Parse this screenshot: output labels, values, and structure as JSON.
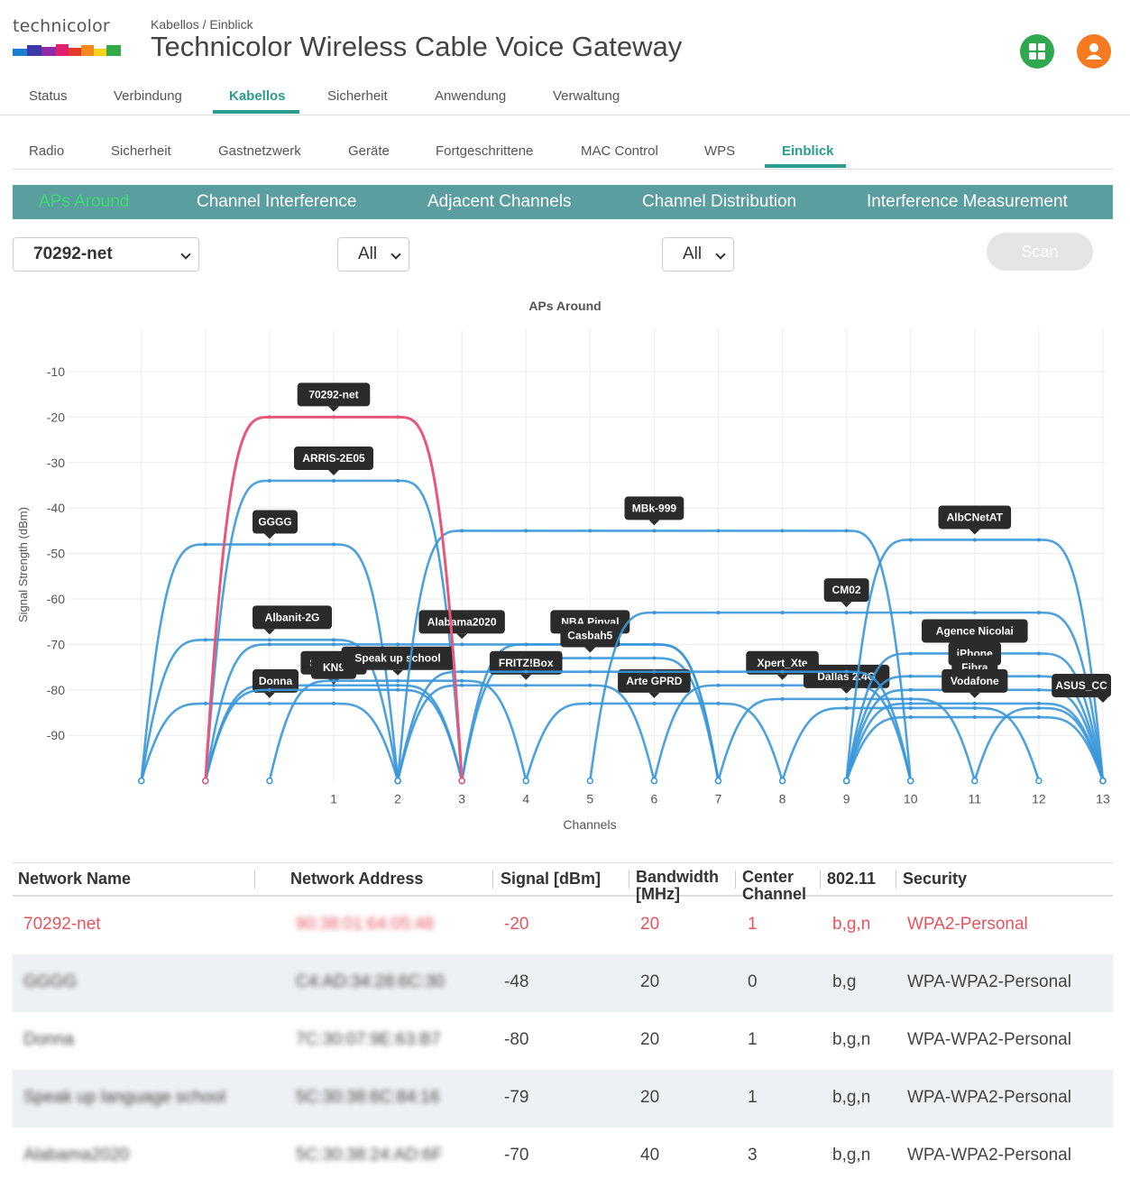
{
  "header": {
    "logo_text": "technicolor",
    "breadcrumb": "Kabellos / Einblick",
    "title": "Technicolor Wireless Cable Voice Gateway"
  },
  "main_nav": {
    "items": [
      "Status",
      "Verbindung",
      "Kabellos",
      "Sicherheit",
      "Anwendung",
      "Verwaltung"
    ],
    "active": "Kabellos"
  },
  "sub_nav": {
    "items": [
      "Radio",
      "Sicherheit",
      "Gastnetzwerk",
      "Geräte",
      "Fortgeschrittene",
      "MAC Control",
      "WPS",
      "Einblick"
    ],
    "active": "Einblick"
  },
  "tabs": {
    "items": [
      "APs Around",
      "Channel Interference",
      "Adjacent Channels",
      "Channel Distribution",
      "Interference Measurement"
    ],
    "active": "APs Around"
  },
  "filters": {
    "network": "70292-net",
    "filter2": "All",
    "filter3": "All",
    "scan_label": "Scan"
  },
  "chart_data": {
    "type": "line",
    "title": "APs Around",
    "xlabel": "Channels",
    "ylabel": "Signal Strength (dBm)",
    "x_ticks": [
      1,
      2,
      3,
      4,
      5,
      6,
      7,
      8,
      9,
      10,
      11,
      12,
      13
    ],
    "xlim": [
      -2,
      13
    ],
    "y_ticks": [
      -10,
      -20,
      -30,
      -40,
      -50,
      -60,
      -70,
      -80,
      -90
    ],
    "ylim": [
      -100,
      -5
    ],
    "grid": true,
    "highlight_color": "#e8577a",
    "series_color": "#3a97d9",
    "series": [
      {
        "name": "70292-net",
        "center": 1,
        "bandwidth": 20,
        "signal": -20,
        "highlight": true
      },
      {
        "name": "ARRIS-2E05",
        "center": 1,
        "bandwidth": 20,
        "signal": -34
      },
      {
        "name": "GGGG",
        "center": 0,
        "bandwidth": 20,
        "signal": -48
      },
      {
        "name": "Albanit-2G",
        "center": 0,
        "bandwidth": 20,
        "signal": -69
      },
      {
        "name": "Speak up",
        "center": 1,
        "bandwidth": 20,
        "signal": -79
      },
      {
        "name": "Donna",
        "center": 0,
        "bandwidth": 20,
        "signal": -83
      },
      {
        "name": "KN9",
        "center": 1,
        "bandwidth": 20,
        "signal": -80
      },
      {
        "name": "Speak up school",
        "center": 2,
        "bandwidth": 20,
        "signal": -78
      },
      {
        "name": "Alabama2020",
        "center": 3,
        "bandwidth": 40,
        "signal": -70
      },
      {
        "name": "MBk-999",
        "center": 6,
        "bandwidth": 40,
        "signal": -45
      },
      {
        "name": "NBA Pinval",
        "center": 5,
        "bandwidth": 20,
        "signal": -70
      },
      {
        "name": "Casbah5",
        "center": 5,
        "bandwidth": 20,
        "signal": -73
      },
      {
        "name": "FRITZ!Box",
        "center": 4,
        "bandwidth": 20,
        "signal": -79
      },
      {
        "name": "Arte GPRD",
        "center": 6,
        "bandwidth": 20,
        "signal": -83
      },
      {
        "name": "Xpert_Xte",
        "center": 8,
        "bandwidth": 20,
        "signal": -79
      },
      {
        "name": "Dallas 2.4G",
        "center": 9,
        "bandwidth": 20,
        "signal": -82
      },
      {
        "name": "CM02",
        "center": 9,
        "bandwidth": 40,
        "signal": -63
      },
      {
        "name": "AlbCNetAT",
        "center": 11,
        "bandwidth": 20,
        "signal": -47
      },
      {
        "name": "Agence Nicolai",
        "center": 11,
        "bandwidth": 20,
        "signal": -72
      },
      {
        "name": "iPhone",
        "center": 11,
        "bandwidth": 20,
        "signal": -77
      },
      {
        "name": "Fibra",
        "center": 11,
        "bandwidth": 20,
        "signal": -80
      },
      {
        "name": "Vodafone",
        "center": 11,
        "bandwidth": 20,
        "signal": -83
      },
      {
        "name": "ASUS_CC",
        "center": 13,
        "bandwidth": 20,
        "signal": -84
      },
      {
        "name": "",
        "center": 10,
        "bandwidth": 20,
        "signal": -84
      },
      {
        "name": "",
        "center": 11,
        "bandwidth": 20,
        "signal": -86
      },
      {
        "name": "",
        "center": 6,
        "bandwidth": 40,
        "signal": -76
      }
    ]
  },
  "table": {
    "headers": [
      "Network Name",
      "Network Address",
      "Signal [dBm]",
      "Bandwidth [MHz]",
      "Center Channel",
      "802.11",
      "Security"
    ],
    "rows": [
      {
        "name": "70292-net",
        "address": "90:38:01:64:05:48",
        "signal": "-20",
        "bandwidth": "20",
        "channel": "1",
        "mode": "b,g,n",
        "security": "WPA2-Personal",
        "own": true
      },
      {
        "name": "GGGG",
        "address": "C4:AD:34:28:6C:30",
        "signal": "-48",
        "bandwidth": "20",
        "channel": "0",
        "mode": "b,g",
        "security": "WPA-WPA2-Personal"
      },
      {
        "name": "Donna",
        "address": "7C:30:07:9E:63:B7",
        "signal": "-80",
        "bandwidth": "20",
        "channel": "1",
        "mode": "b,g,n",
        "security": "WPA-WPA2-Personal"
      },
      {
        "name": "Speak up language school",
        "address": "5C:30:38:6C:84:16",
        "signal": "-79",
        "bandwidth": "20",
        "channel": "1",
        "mode": "b,g,n",
        "security": "WPA-WPA2-Personal"
      },
      {
        "name": "Alabama2020",
        "address": "5C:30:38:24:AD:6F",
        "signal": "-70",
        "bandwidth": "40",
        "channel": "3",
        "mode": "b,g,n",
        "security": "WPA-WPA2-Personal"
      }
    ]
  }
}
